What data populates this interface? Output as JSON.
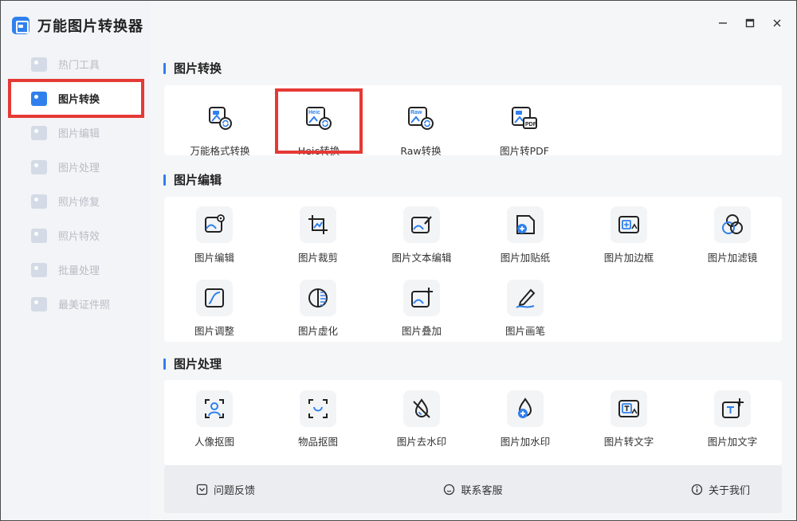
{
  "app": {
    "title": "万能图片转换器"
  },
  "window_controls": {
    "minimize": "—",
    "maximize": "☐",
    "close": "✕"
  },
  "sidebar": {
    "items": [
      {
        "label": "热门工具",
        "active": false
      },
      {
        "label": "图片转换",
        "active": true
      },
      {
        "label": "图片编辑",
        "active": false
      },
      {
        "label": "图片处理",
        "active": false
      },
      {
        "label": "照片修复",
        "active": false
      },
      {
        "label": "照片特效",
        "active": false
      },
      {
        "label": "批量处理",
        "active": false
      },
      {
        "label": "最美证件照",
        "active": false
      }
    ]
  },
  "sections": {
    "convert": {
      "title": "图片转换",
      "tools": [
        {
          "label": "万能格式转换",
          "icon": "format-convert-icon"
        },
        {
          "label": "Heic转换",
          "icon": "heic-icon",
          "tag": "Heic"
        },
        {
          "label": "Raw转换",
          "icon": "raw-icon",
          "tag": "Raw"
        },
        {
          "label": "图片转PDF",
          "icon": "pdf-icon",
          "tag": "PDF"
        }
      ]
    },
    "edit": {
      "title": "图片编辑",
      "tools": [
        {
          "label": "图片编辑",
          "icon": "image-edit-icon"
        },
        {
          "label": "图片裁剪",
          "icon": "crop-icon"
        },
        {
          "label": "图片文本编辑",
          "icon": "text-edit-icon"
        },
        {
          "label": "图片加贴纸",
          "icon": "sticker-icon"
        },
        {
          "label": "图片加边框",
          "icon": "frame-icon"
        },
        {
          "label": "图片加滤镜",
          "icon": "filter-icon"
        },
        {
          "label": "图片调整",
          "icon": "adjust-icon"
        },
        {
          "label": "图片虚化",
          "icon": "blur-icon"
        },
        {
          "label": "图片叠加",
          "icon": "overlay-icon"
        },
        {
          "label": "图片画笔",
          "icon": "brush-icon"
        }
      ]
    },
    "process": {
      "title": "图片处理",
      "tools": [
        {
          "label": "人像抠图",
          "icon": "portrait-cutout-icon"
        },
        {
          "label": "物品抠图",
          "icon": "object-cutout-icon"
        },
        {
          "label": "图片去水印",
          "icon": "remove-watermark-icon"
        },
        {
          "label": "图片加水印",
          "icon": "add-watermark-icon"
        },
        {
          "label": "图片转文字",
          "icon": "image-to-text-icon"
        },
        {
          "label": "图片加文字",
          "icon": "add-text-icon"
        }
      ]
    }
  },
  "bottom": {
    "feedback": "问题反馈",
    "support": "联系客服",
    "about": "关于我们"
  },
  "colors": {
    "accent": "#2f80ed",
    "highlight": "#e53935"
  }
}
